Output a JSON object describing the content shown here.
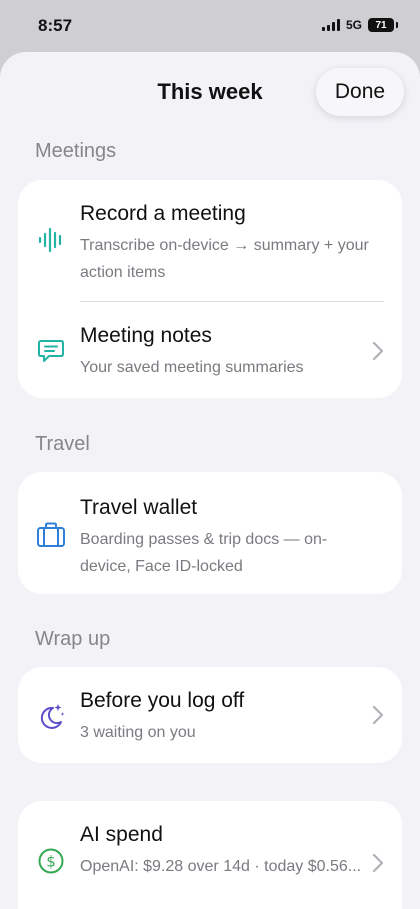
{
  "status": {
    "time": "8:57",
    "network": "5G",
    "battery": "71"
  },
  "header": {
    "title": "This week",
    "done_label": "Done"
  },
  "sections": [
    {
      "title": "Meetings",
      "items": [
        {
          "title": "Record a meeting",
          "subtitle": "Transcribe on-device → summary + your action items",
          "icon": "waveform-icon"
        },
        {
          "title": "Meeting notes",
          "subtitle": "Your saved meeting summaries",
          "icon": "message-bubble-icon"
        }
      ]
    },
    {
      "title": "Travel",
      "items": [
        {
          "title": "Travel wallet",
          "subtitle": "Boarding passes & trip docs — on-device, Face ID-locked",
          "icon": "briefcase-icon"
        }
      ]
    },
    {
      "title": "Wrap up",
      "items": [
        {
          "title": "Before you log off",
          "subtitle": "3 waiting on you",
          "icon": "moon-stars-icon"
        }
      ]
    },
    {
      "title": "",
      "items": [
        {
          "title": "AI spend",
          "subtitle": "OpenAI: $9.28 over 14d · today $0.56...",
          "icon": "dollar-circle-icon"
        }
      ]
    }
  ],
  "colors": {
    "teal": "#22b3a6",
    "blue": "#2f80d8",
    "purple": "#5b4fc9",
    "green": "#34a853"
  }
}
